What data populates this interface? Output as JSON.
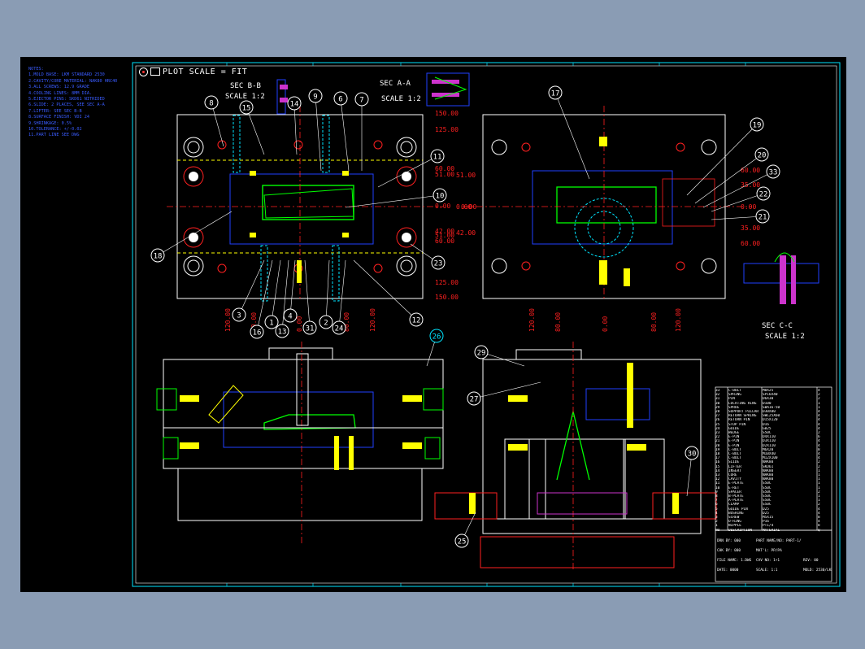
{
  "colors": {
    "frame": "#00e5ff",
    "dimension": "#ff2020",
    "hidden": "#ffff00",
    "part": "#00ff00",
    "detail": "#2040ff",
    "border": "#ffffff"
  },
  "notes": {
    "lines": [
      "NOTES:",
      "1.MOLD BASE: LKM STANDARD 2530",
      "2.CAVITY/CORE MATERIAL: NAK80 HRC40",
      "3.ALL SCREWS: 12.9 GRADE",
      "4.COOLING LINES: 8MM DIA.",
      "5.EJECTOR PINS: SKD61 NITRIDED",
      "6.SLIDE: 2 PLACES, SEE SEC A-A",
      "7.LIFTER: SEE SEC B-B",
      "8.SURFACE FINISH: VDI 24",
      "9.SHRINKAGE: 0.5%",
      "10.TOLERANCE: +/-0.02",
      "11.PART LINE SEE DWG"
    ]
  },
  "plot_bar": {
    "label": "PLOT SCALE = FIT"
  },
  "sections": {
    "b": [
      "SEC B-B",
      "SCALE 1:2"
    ],
    "a": [
      "SEC A-A",
      "SCALE 1:2"
    ],
    "c": [
      "SEC C-C",
      "SCALE 1:2"
    ]
  },
  "dims_right_left": [
    "150.00",
    "125.00",
    "60.00",
    "51.00",
    "0.00",
    "42.00",
    "51.00",
    "60.00",
    "125.00",
    "150.00"
  ],
  "dims_right_right": [
    "60.00",
    "35.00",
    "0.00",
    "35.00",
    "60.00"
  ],
  "dims_left_left": [
    "0.00"
  ],
  "dims_left_right": [
    "51.00",
    "0.00",
    "42.00"
  ],
  "dims_bottom_left": [
    "120.00",
    "80.00",
    "0.00",
    "80.00",
    "120.00"
  ],
  "dims_bottom_right": [
    "120.00",
    "80.00",
    "0.00",
    "80.00",
    "120.00"
  ],
  "balloons": [
    "8",
    "15",
    "14",
    "9",
    "6",
    "7",
    "11",
    "10",
    "18",
    "3",
    "16",
    "1",
    "13",
    "4",
    "31",
    "2",
    "24",
    "12",
    "23",
    "17",
    "19",
    "20",
    "33",
    "22",
    "21",
    "26",
    "29",
    "27",
    "30",
    "25"
  ],
  "title_block": {
    "rows": [
      {
        "no": "33",
        "name": "C-BOLT",
        "spec": "M8X25",
        "qty": "4"
      },
      {
        "no": "32",
        "name": "SPRING",
        "spec": "SP16X40",
        "qty": "2"
      },
      {
        "no": "31",
        "name": "PIN",
        "spec": "D6X30",
        "qty": "2"
      },
      {
        "no": "30",
        "name": "LOCATING RING",
        "spec": "D100",
        "qty": "1"
      },
      {
        "no": "29",
        "name": "SPRUE",
        "spec": "SBA16-50",
        "qty": "1"
      },
      {
        "no": "28",
        "name": "SUPPORT PILLAR",
        "spec": "D30X80",
        "qty": "4"
      },
      {
        "no": "27",
        "name": "RETURN SPRING",
        "spec": "SWL25X60",
        "qty": "4"
      },
      {
        "no": "26",
        "name": "RETURN PIN",
        "spec": "D15X120",
        "qty": "4"
      },
      {
        "no": "25",
        "name": "STOP PIN",
        "spec": "D16",
        "qty": "4"
      },
      {
        "no": "24",
        "name": "GUIDE",
        "spec": "GB25",
        "qty": "4"
      },
      {
        "no": "23",
        "name": "WEDGE",
        "spec": "S50C",
        "qty": "2"
      },
      {
        "no": "22",
        "name": "E-PIN",
        "spec": "D4X110",
        "qty": "6"
      },
      {
        "no": "21",
        "name": "E-PIN",
        "spec": "D3X110",
        "qty": "4"
      },
      {
        "no": "20",
        "name": "E-PIN",
        "spec": "D2X110",
        "qty": "4"
      },
      {
        "no": "19",
        "name": "C-BOLT",
        "spec": "M6X20",
        "qty": "8"
      },
      {
        "no": "18",
        "name": "C-BOLT",
        "spec": "M10X40",
        "qty": "4"
      },
      {
        "no": "17",
        "name": "C-BOLT",
        "spec": "M12X100",
        "qty": "4"
      },
      {
        "no": "16",
        "name": "SLIDE",
        "spec": "NAK80",
        "qty": "2"
      },
      {
        "no": "15",
        "name": "LIFTER",
        "spec": "SKD61",
        "qty": "2"
      },
      {
        "no": "14",
        "name": "INSERT",
        "spec": "NAK80",
        "qty": "1"
      },
      {
        "no": "13",
        "name": "CORE",
        "spec": "NAK80",
        "qty": "1"
      },
      {
        "no": "12",
        "name": "CAVITY",
        "spec": "NAK80",
        "qty": "1"
      },
      {
        "no": "11",
        "name": "E-PLATE",
        "spec": "S50C",
        "qty": "1"
      },
      {
        "no": "10",
        "name": "E-RET",
        "spec": "S50C",
        "qty": "1"
      },
      {
        "no": "9",
        "name": "SPACER",
        "spec": "S50C",
        "qty": "2"
      },
      {
        "no": "8",
        "name": "B-PLATE",
        "spec": "S50C",
        "qty": "1"
      },
      {
        "no": "7",
        "name": "A-PLATE",
        "spec": "S50C",
        "qty": "1"
      },
      {
        "no": "6",
        "name": "CLAMP",
        "spec": "S50C",
        "qty": "2"
      },
      {
        "no": "5",
        "name": "GUIDE PIN",
        "spec": "D25",
        "qty": "4"
      },
      {
        "no": "4",
        "name": "BUSHING",
        "spec": "D25",
        "qty": "4"
      },
      {
        "no": "3",
        "name": "SCREW",
        "spec": "M5X15",
        "qty": "8"
      },
      {
        "no": "2",
        "name": "O-RING",
        "spec": "P16",
        "qty": "4"
      },
      {
        "no": "1",
        "name": "NIPPLE",
        "spec": "PT1/4",
        "qty": "8"
      },
      {
        "no": "NO",
        "name": "DESCRIPTION",
        "spec": "MATERIAL",
        "qty": "Q"
      }
    ],
    "footer": [
      {
        "a": "DRN BY: 000",
        "b": "PART NAME/NO: PART-1/1"
      },
      {
        "a": "CHK BY: 000",
        "b": "MAT'L: PP/PA"
      },
      {
        "a": "FILE NAME: 1.DWG",
        "b": "CAV NO: 1+1",
        "c": "REV: 00"
      },
      {
        "a": "DATE: 0000",
        "b": "SCALE: 1:1",
        "c": "MOLD: 2530/LKM BASE-0"
      }
    ]
  }
}
